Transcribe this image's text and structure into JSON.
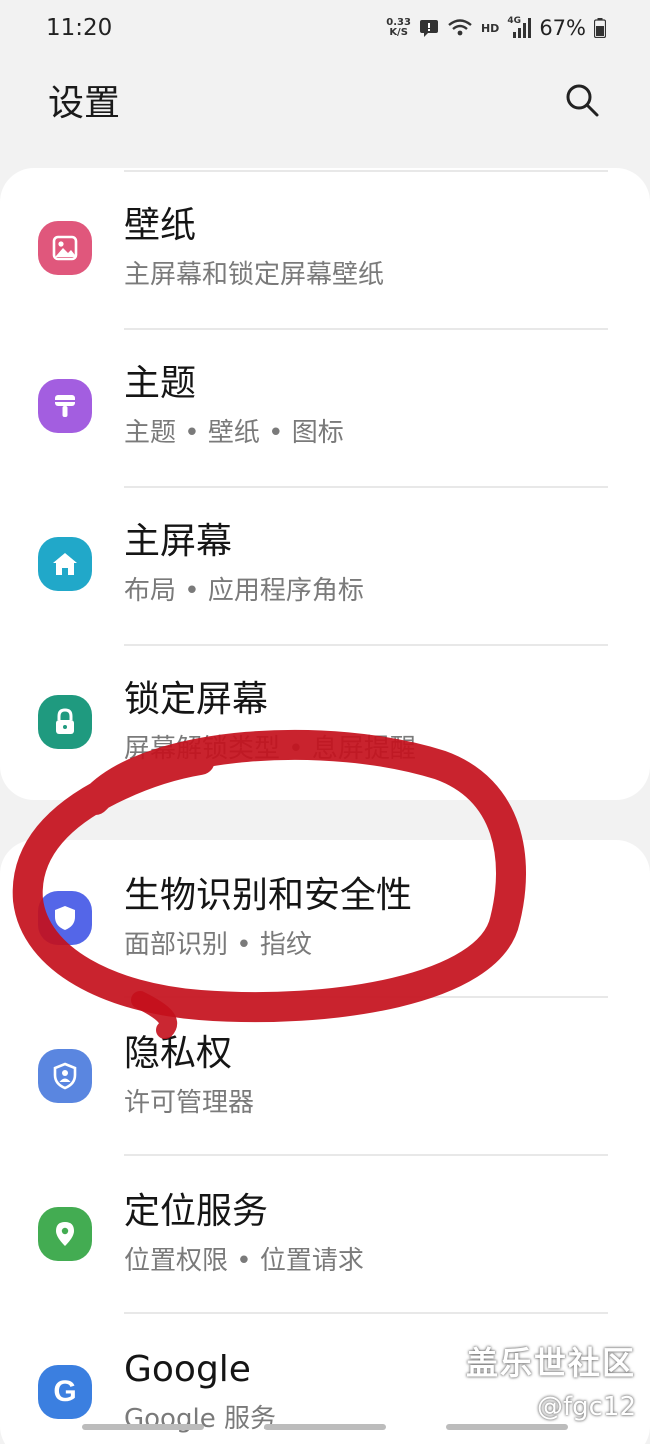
{
  "status_bar": {
    "time": "11:20",
    "net_speed_value": "0.33",
    "net_speed_unit": "K/S",
    "hd": "HD",
    "network": "4G",
    "battery": "67%"
  },
  "header": {
    "title": "设置",
    "search_icon": "search-icon"
  },
  "settings_items": [
    {
      "title": "壁纸",
      "subtitle": "主屏幕和锁定屏幕壁纸",
      "icon": "wallpaper-icon",
      "color": "#e0577c"
    },
    {
      "title": "主题",
      "subtitle": "主题 • 壁纸 • 图标",
      "icon": "theme-brush-icon",
      "color": "#a35ee0"
    },
    {
      "title": "主屏幕",
      "subtitle": "布局 • 应用程序角标",
      "icon": "home-icon",
      "color": "#21a8c9"
    },
    {
      "title": "锁定屏幕",
      "subtitle": "屏幕解锁类型 • 息屏提醒",
      "icon": "lock-icon",
      "color": "#1f9a7f"
    },
    {
      "title": "生物识别和安全性",
      "subtitle": "面部识别 • 指纹",
      "icon": "shield-icon",
      "color": "#5466e8"
    },
    {
      "title": "隐私权",
      "subtitle": "许可管理器",
      "icon": "privacy-shield-icon",
      "color": "#5a86e0"
    },
    {
      "title": "定位服务",
      "subtitle": "位置权限 • 位置请求",
      "icon": "location-pin-icon",
      "color": "#43ac52"
    },
    {
      "title": "Google",
      "subtitle": "Google 服务",
      "icon": "google-icon",
      "color": "#3b7fe0"
    }
  ],
  "annotation_color": "#c4101c",
  "watermark": {
    "line1": "盖乐世社区",
    "line2": "@fgc12"
  }
}
